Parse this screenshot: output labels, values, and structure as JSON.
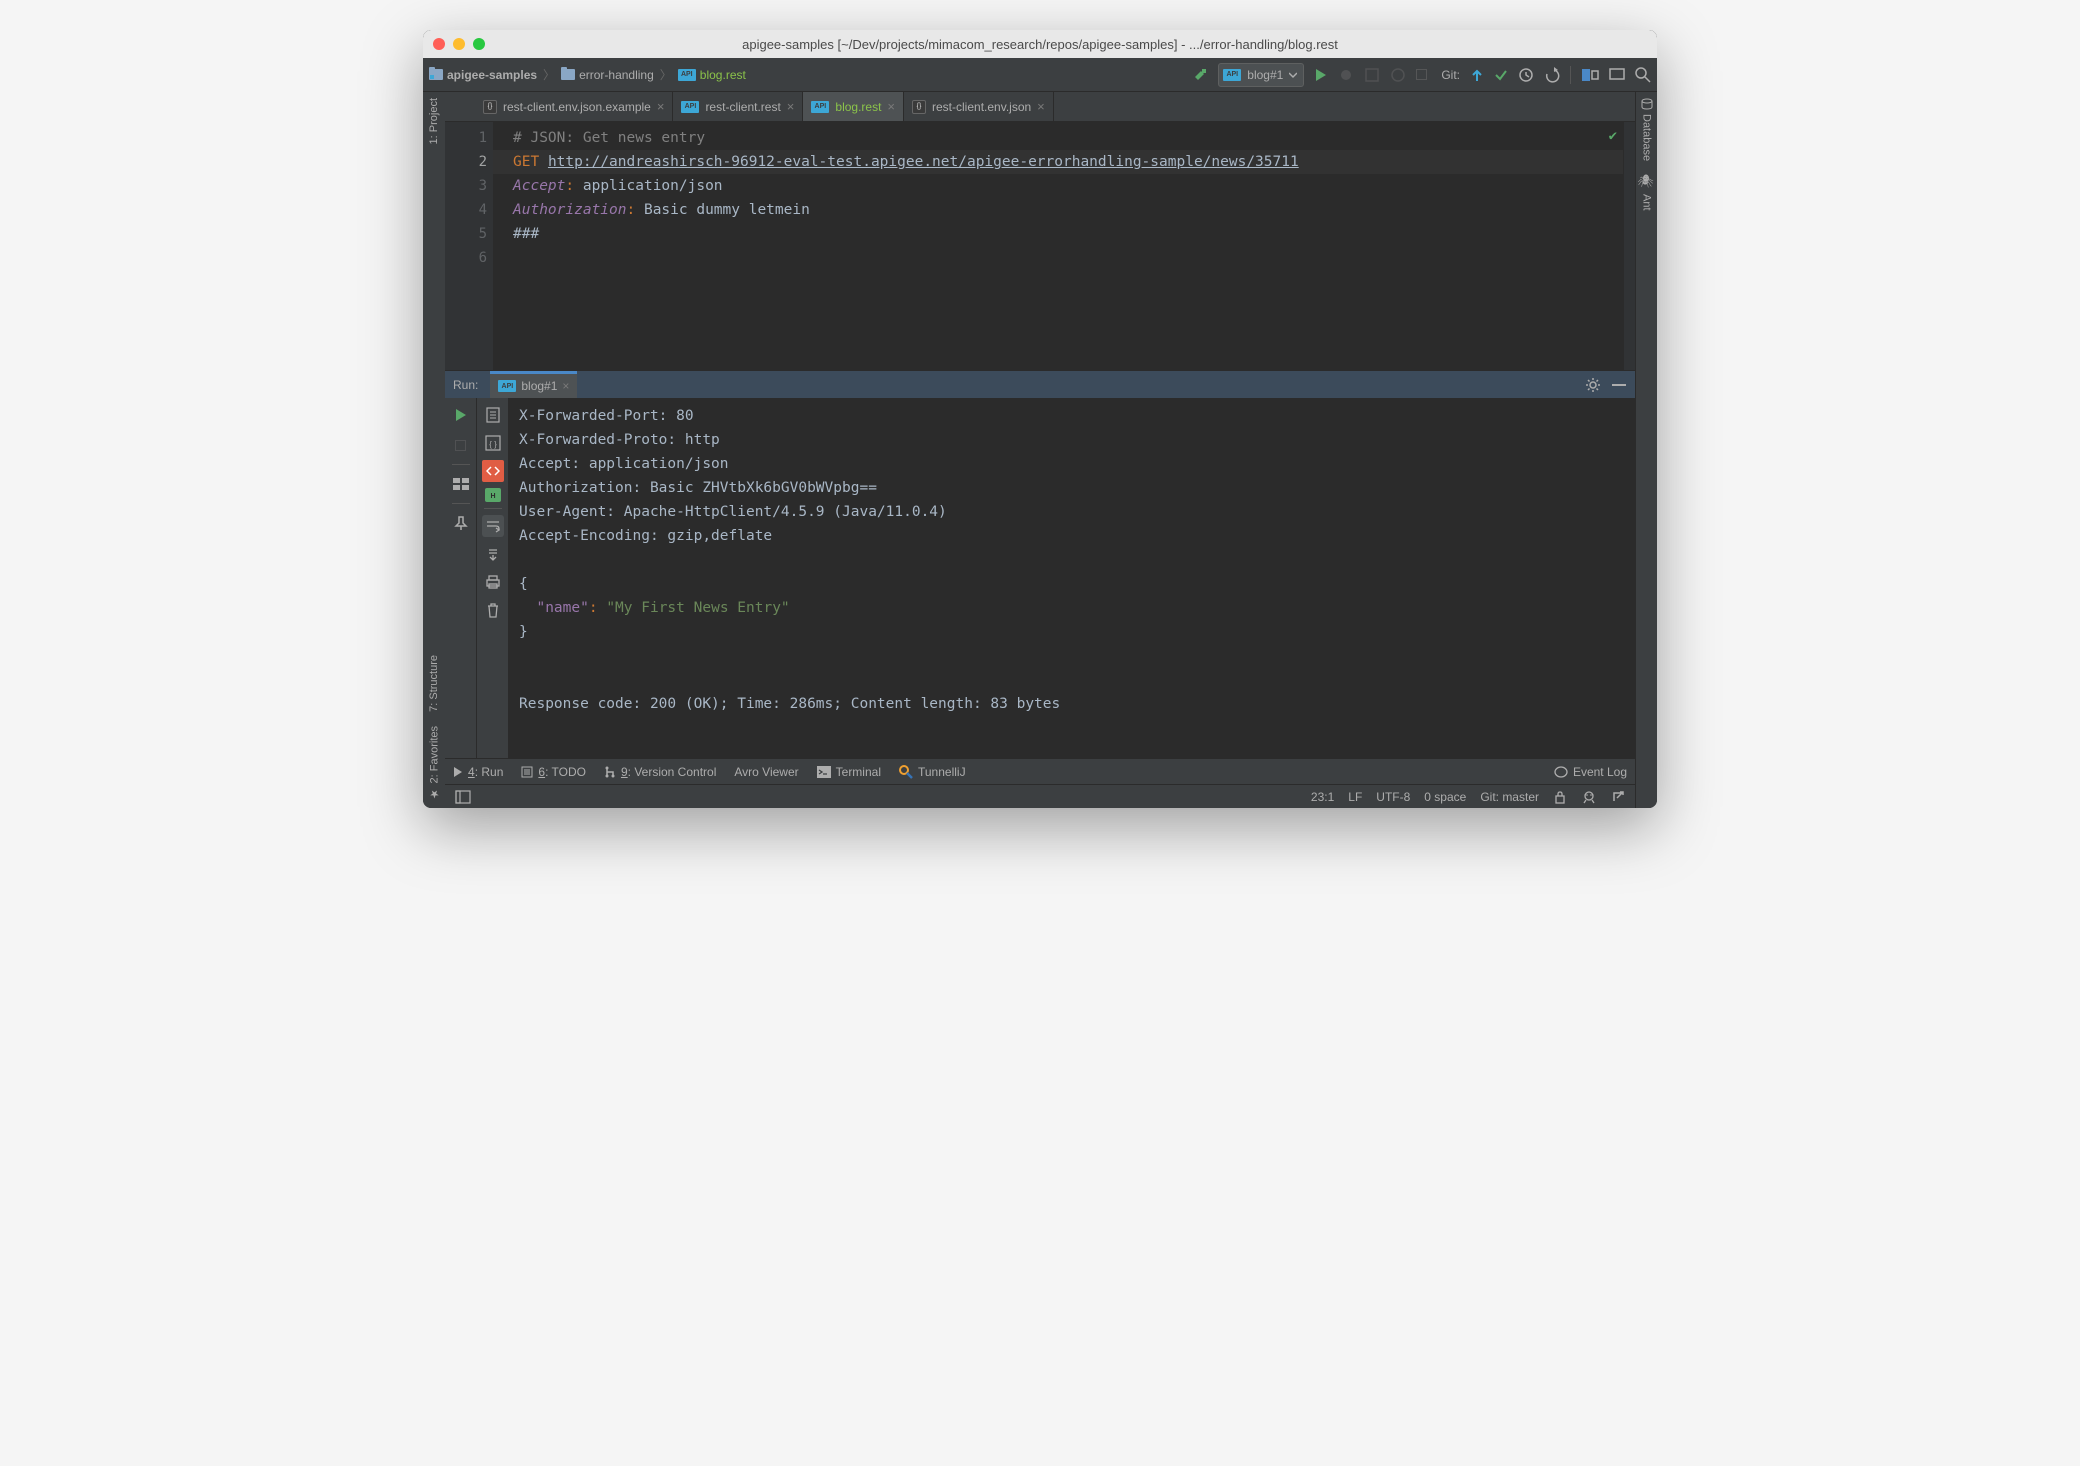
{
  "window": {
    "title": "apigee-samples [~/Dev/projects/mimacom_research/repos/apigee-samples] - .../error-handling/blog.rest"
  },
  "breadcrumb": {
    "items": [
      "apigee-samples",
      "error-handling",
      "blog.rest"
    ]
  },
  "toolbar": {
    "run_config": "blog#1",
    "git_label": "Git:"
  },
  "tabs": [
    {
      "label": "rest-client.env.json.example",
      "active": false,
      "type": "json"
    },
    {
      "label": "rest-client.rest",
      "active": false,
      "type": "api"
    },
    {
      "label": "blog.rest",
      "active": true,
      "type": "api"
    },
    {
      "label": "rest-client.env.json",
      "active": false,
      "type": "json"
    }
  ],
  "editor": {
    "lines": [
      {
        "n": "1",
        "type": "comment",
        "text": "# JSON: Get news entry"
      },
      {
        "n": "2",
        "type": "request",
        "method": "GET",
        "url": "http://andreashirsch-96912-eval-test.apigee.net/apigee-errorhandling-sample/news/35711"
      },
      {
        "n": "3",
        "type": "header",
        "key": "Accept",
        "value": "application/json"
      },
      {
        "n": "4",
        "type": "header",
        "key": "Authorization",
        "value": "Basic dummy letmein"
      },
      {
        "n": "5",
        "type": "blank",
        "text": ""
      },
      {
        "n": "6",
        "type": "plain",
        "text": "###"
      }
    ],
    "current_line": 2
  },
  "sidebar_tools": {
    "left": [
      "1: Project",
      "7: Structure",
      "2: Favorites"
    ],
    "right": [
      "Database",
      "Ant"
    ]
  },
  "run_panel": {
    "label": "Run:",
    "tab": "blog#1",
    "headers": [
      "X-Forwarded-Port: 80",
      "X-Forwarded-Proto: http",
      "Accept: application/json",
      "Authorization: Basic ZHVtbXk6bGV0bWVpbg==",
      "User-Agent: Apache-HttpClient/4.5.9 (Java/11.0.4)",
      "Accept-Encoding: gzip,deflate"
    ],
    "json_body": {
      "key": "\"name\"",
      "value": "\"My First News Entry\""
    },
    "summary": "Response code: 200 (OK); Time: 286ms; Content length: 83 bytes"
  },
  "bottom_bar": {
    "run": "4: Run",
    "todo": "6: TODO",
    "vcs": "9: Version Control",
    "avro": "Avro Viewer",
    "terminal": "Terminal",
    "tunnel": "TunnelliJ",
    "event_log": "Event Log"
  },
  "status": {
    "pos": "23:1",
    "line_ending": "LF",
    "encoding": "UTF-8",
    "indent": "0 space",
    "git": "Git: master"
  }
}
